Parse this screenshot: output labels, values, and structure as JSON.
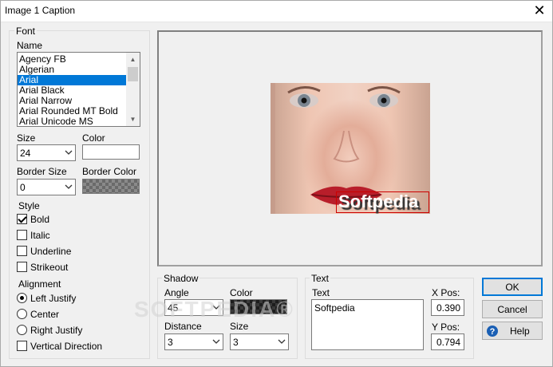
{
  "window": {
    "title": "Image 1 Caption",
    "close_glyph": "✕"
  },
  "font": {
    "group_label": "Font",
    "name_label": "Name",
    "names": [
      "Agency FB",
      "Algerian",
      "Arial",
      "Arial Black",
      "Arial Narrow",
      "Arial Rounded MT Bold",
      "Arial Unicode MS"
    ],
    "selected_name": "Arial",
    "size_label": "Size",
    "size_value": "24",
    "color_label": "Color",
    "color_value": "#ffffff",
    "border_size_label": "Border Size",
    "border_size_value": "0",
    "border_color_label": "Border Color"
  },
  "style": {
    "label": "Style",
    "bold": {
      "label": "Bold",
      "checked": true
    },
    "italic": {
      "label": "Italic",
      "checked": false
    },
    "underline": {
      "label": "Underline",
      "checked": false
    },
    "strikeout": {
      "label": "Strikeout",
      "checked": false
    }
  },
  "alignment": {
    "label": "Alignment",
    "left": {
      "label": "Left Justify",
      "selected": true
    },
    "center": {
      "label": "Center",
      "selected": false
    },
    "right": {
      "label": "Right Justify",
      "selected": false
    },
    "vertical": {
      "label": "Vertical Direction",
      "checked": false
    }
  },
  "preview": {
    "caption_text": "Softpedia"
  },
  "shadow": {
    "group_label": "Shadow",
    "angle_label": "Angle",
    "angle_value": "45",
    "color_label": "Color",
    "distance_label": "Distance",
    "distance_value": "3",
    "size_label": "Size",
    "size_value": "3"
  },
  "text": {
    "group_label": "Text",
    "text_label": "Text",
    "text_value": "Softpedia",
    "xpos_label": "X Pos:",
    "xpos_value": "0.390",
    "ypos_label": "Y Pos:",
    "ypos_value": "0.794"
  },
  "buttons": {
    "ok": "OK",
    "cancel": "Cancel",
    "help": "Help"
  },
  "watermark": "SOFTPEDIA®",
  "colors": {
    "selection": "#0078d7",
    "caption_border": "#cc0000",
    "help_icon": "#1a5fb4"
  }
}
